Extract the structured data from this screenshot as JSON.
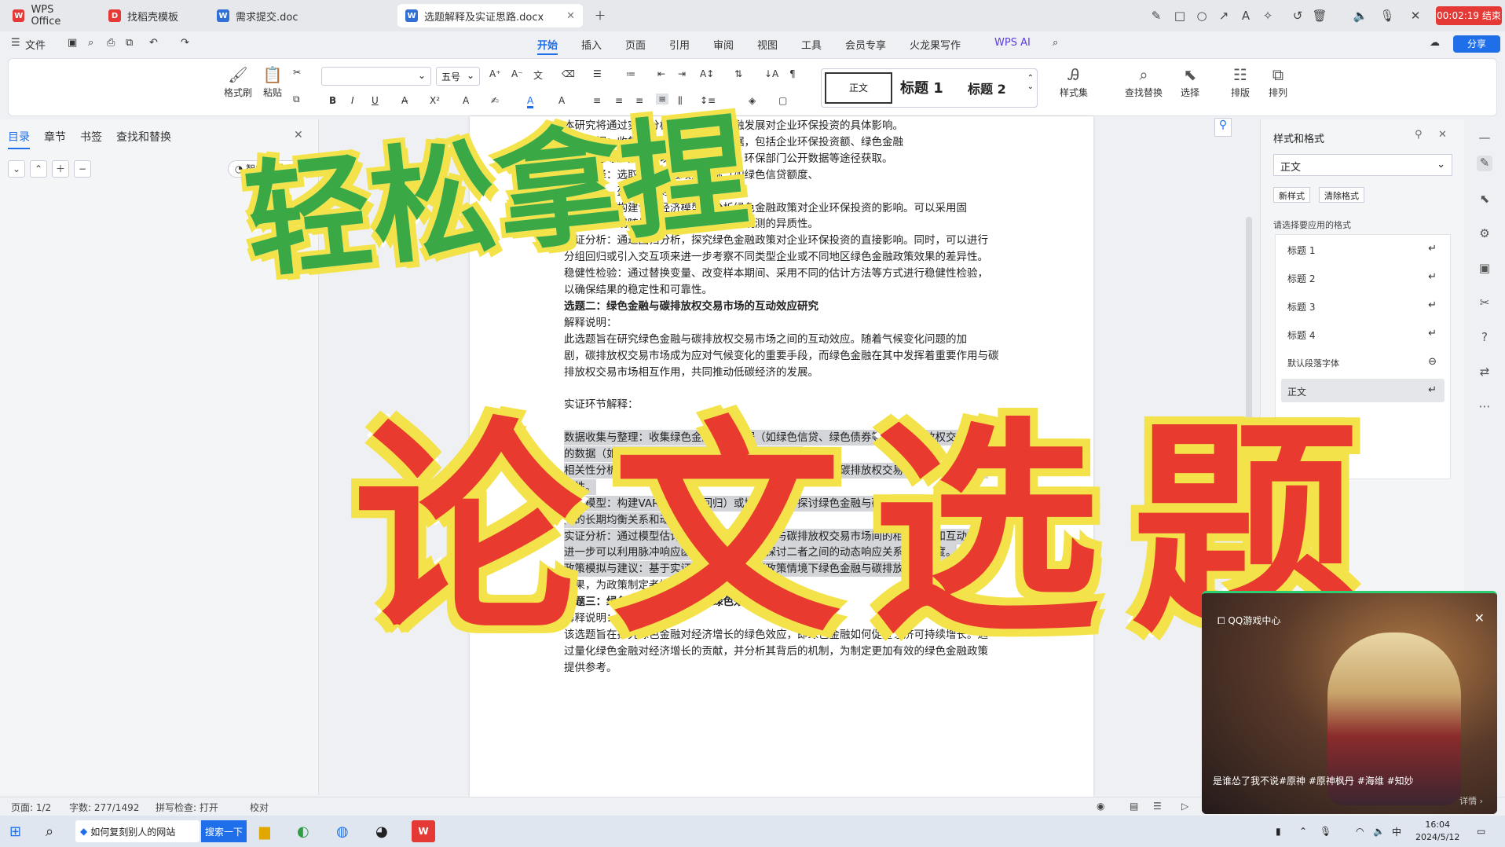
{
  "tabs": [
    {
      "label": "WPS Office",
      "icon": "wps-logo-icon"
    },
    {
      "label": "找稻壳模板",
      "icon": "docer-icon"
    },
    {
      "label": "需求提交.doc",
      "icon": "word-doc-icon"
    },
    {
      "label": "选题解释及实证思路.docx",
      "icon": "word-doc-icon"
    }
  ],
  "recording_timer": "00:02:19 结束",
  "menu": {
    "file": "文件",
    "items": [
      "开始",
      "插入",
      "页面",
      "引用",
      "审阅",
      "视图",
      "工具",
      "会员专享",
      "火龙果写作",
      "WPS AI"
    ],
    "share": "分享"
  },
  "ribbon": {
    "format_painter": "格式刷",
    "paste": "粘贴",
    "font_name": "",
    "font_size": "五号",
    "style_normal": "正文",
    "style_h1": "标题 1",
    "style_h2": "标题 2",
    "style_set": "样式集",
    "find_replace": "查找替换",
    "select": "选择",
    "layout": "排版",
    "arrange": "排列"
  },
  "left_panel": {
    "tabs": [
      "目录",
      "章节",
      "书签",
      "查找和替换"
    ],
    "smart_toc": "智能识别目录"
  },
  "document": {
    "lines": [
      {
        "text": "本研究将通过实证分析，探讨绿色金融发展对企业环保投资的具体影响。",
        "style": "normal"
      },
      {
        "text": "收集数据：收集企业环保投资相关数据，包括企业环保投资额、绿色金融",
        "style": "normal"
      },
      {
        "text": "政策信息等。数据可以通过企业年报、环保部门公开数据等途径获取。",
        "style": "normal"
      },
      {
        "text": "变量选择：选取绿色金融政策指标（如绿色信贷额度、",
        "style": "normal"
      },
      {
        "text": "企业规模、盈利能力等。",
        "style": "normal"
      },
      {
        "text": "模型构建：构建计量经济模型，分析绿色金融政策对企业环保投资的影响。可以采用固",
        "style": "normal"
      },
      {
        "text": "定效应模型或随机效应模型来控制不可观测的异质性。",
        "style": "normal"
      },
      {
        "text": "实证分析：通过回归分析，探究绿色金融政策对企业环保投资的直接影响。同时，可以进行",
        "style": "normal"
      },
      {
        "text": "分组回归或引入交互项来进一步考察不同类型企业或不同地区绿色金融政策效果的差异性。",
        "style": "normal"
      },
      {
        "text": "稳健性检验：通过替换变量、改变样本期间、采用不同的估计方法等方式进行稳健性检验，",
        "style": "normal"
      },
      {
        "text": "以确保结果的稳定性和可靠性。",
        "style": "normal"
      },
      {
        "text": "选题二：绿色金融与碳排放权交易市场的互动效应研究",
        "style": "bold"
      },
      {
        "text": "解释说明：",
        "style": "normal"
      },
      {
        "text": "此选题旨在研究绿色金融与碳排放权交易市场之间的互动效应。随着气候变化问题的加",
        "style": "normal"
      },
      {
        "text": "剧，碳排放权交易市场成为应对气候变化的重要手段，而绿色金融在其中发挥着重要作用与碳",
        "style": "normal"
      },
      {
        "text": "排放权交易市场相互作用，共同推动低碳经济的发展。",
        "style": "normal"
      },
      {
        "text": "",
        "style": "normal"
      },
      {
        "text": "实证环节解释：",
        "style": "normal"
      },
      {
        "text": "",
        "style": "normal"
      },
      {
        "text": "数据收集与整理：收集绿色金融相关数据（如绿色信贷、绿色债券等）与碳排放权交易市场",
        "style": "hl"
      },
      {
        "text": "的数据（如碳排放权价格、交易量、成交价格等）。",
        "style": "hl"
      },
      {
        "text": "相关性分析：通过相关性分析初步探讨绿色金融发展指标与碳排放权交易市场指标之间的相",
        "style": "hl"
      },
      {
        "text": "关性。",
        "style": "hl"
      },
      {
        "text": "建立模型：构建VAR（向量自回归）或协整模型，探讨绿色金融与碳排放权交易市场之",
        "style": "hl"
      },
      {
        "text": "间的长期均衡关系和动态互动。",
        "style": "hl"
      },
      {
        "text": "实证分析：通过模型估计结果，分析绿色金融与碳排放权交易市场间的相互影响和互动效应。",
        "style": "hl"
      },
      {
        "text": "进一步可以利用脉冲响应函数和方差分解来探讨二者之间的动态响应关系和贡献度。",
        "style": "hl"
      },
      {
        "text": "政策模拟与建议：基于实证结果，模拟不同政策情境下绿色金融与碳排放权交易市场的互动",
        "style": "hl"
      },
      {
        "text": "效果，为政策制定者提供决策支持。",
        "style": "normal"
      },
      {
        "text": "选题三：绿色金融对经济增长的绿色效应研究",
        "style": "bold"
      },
      {
        "text": "解释说明：",
        "style": "normal"
      },
      {
        "text": "该选题旨在探究绿色金融对经济增长的绿色效应，即绿色金融如何促进经济可持续增长。通",
        "style": "normal"
      },
      {
        "text": "过量化绿色金融对经济增长的贡献，并分析其背后的机制，为制定更加有效的绿色金融政策",
        "style": "normal"
      },
      {
        "text": "提供参考。",
        "style": "normal"
      }
    ]
  },
  "right_panel": {
    "title": "样式和格式",
    "current_style": "正文",
    "new_style": "新样式",
    "clear_format": "清除格式",
    "hint": "请选择要应用的格式",
    "styles": [
      "标题 1",
      "标题 2",
      "标题 3",
      "标题 4",
      "默认段落字体",
      "正文"
    ]
  },
  "status": {
    "page": "页面: 1/2",
    "words": "字数: 277/1492",
    "spell": "拼写检查: 打开",
    "proof": "校对"
  },
  "overlay": {
    "line1": "轻松拿捏",
    "line2": "论文选题"
  },
  "popup": {
    "title": "QQ游戏中心",
    "caption": "是谁怂了我不说#原神 #原神枫丹 #海维 #知妙",
    "detail": "详情 ›"
  },
  "taskbar": {
    "search_text": "如何复刻别人的网站",
    "search_button": "搜索一下",
    "time": "16:04",
    "date": "2024/5/12",
    "ime": "中"
  }
}
